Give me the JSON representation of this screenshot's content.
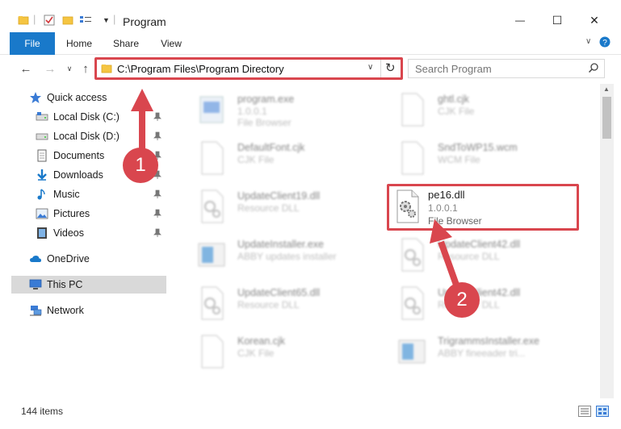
{
  "window": {
    "title": "Program",
    "minimize_glyph": "—",
    "maximize_glyph": "☐",
    "close_glyph": "✕"
  },
  "ribbon": {
    "tabs": [
      "File",
      "Home",
      "Share",
      "View"
    ]
  },
  "address_bar": {
    "path": "C:\\Program Files\\Program Directory"
  },
  "search": {
    "placeholder": "Search Program"
  },
  "sidebar": {
    "quick_access": "Quick access",
    "items": [
      {
        "label": "Local Disk (C:)",
        "icon": "drive-icon"
      },
      {
        "label": "Local Disk (D:)",
        "icon": "drive-icon"
      },
      {
        "label": "Documents",
        "icon": "documents-icon"
      },
      {
        "label": "Downloads",
        "icon": "download-icon"
      },
      {
        "label": "Music",
        "icon": "music-icon"
      },
      {
        "label": "Pictures",
        "icon": "pictures-icon"
      },
      {
        "label": "Videos",
        "icon": "videos-icon"
      }
    ],
    "onedrive": "OneDrive",
    "this_pc": "This PC",
    "network": "Network"
  },
  "files": [
    {
      "name": "program.exe",
      "line1": "1.0.0.1",
      "line2": "File Browser",
      "icon": "exe-icon"
    },
    {
      "name": "ghtl.cjk",
      "line1": "CJK File",
      "line2": "",
      "icon": "blank-file-icon"
    },
    {
      "name": "DefaultFont.cjk",
      "line1": "CJK File",
      "line2": "",
      "icon": "blank-file-icon"
    },
    {
      "name": "SndToWP15.wcm",
      "line1": "WCM File",
      "line2": "",
      "icon": "blank-file-icon"
    },
    {
      "name": "UpdateClient19.dll",
      "line1": "Resource DLL",
      "line2": "",
      "icon": "dll-icon"
    },
    {
      "name": "pe16.dll",
      "line1": "1.0.0.1",
      "line2": "File Browser",
      "icon": "dll-icon"
    },
    {
      "name": "UpdateInstaller.exe",
      "line1": "ABBY updates installer",
      "line2": "",
      "icon": "installer-icon"
    },
    {
      "name": "UpdateClient42.dll",
      "line1": "Resource DLL",
      "line2": "",
      "icon": "dll-icon"
    },
    {
      "name": "UpdateClient65.dll",
      "line1": "Resource DLL",
      "line2": "",
      "icon": "dll-icon"
    },
    {
      "name": "UpdateClient42.dll",
      "line1": "Resource DLL",
      "line2": "",
      "icon": "dll-icon"
    },
    {
      "name": "Korean.cjk",
      "line1": "CJK File",
      "line2": "",
      "icon": "blank-file-icon"
    },
    {
      "name": "TrigrammsInstaller.exe",
      "line1": "ABBY fineeader tri...",
      "line2": "",
      "icon": "installer-icon"
    }
  ],
  "status": {
    "item_count": "144 items"
  },
  "callouts": [
    "1",
    "2"
  ],
  "colors": {
    "accent": "#1979ca",
    "highlight": "#d9464e",
    "selection": "#d9d9d9"
  }
}
